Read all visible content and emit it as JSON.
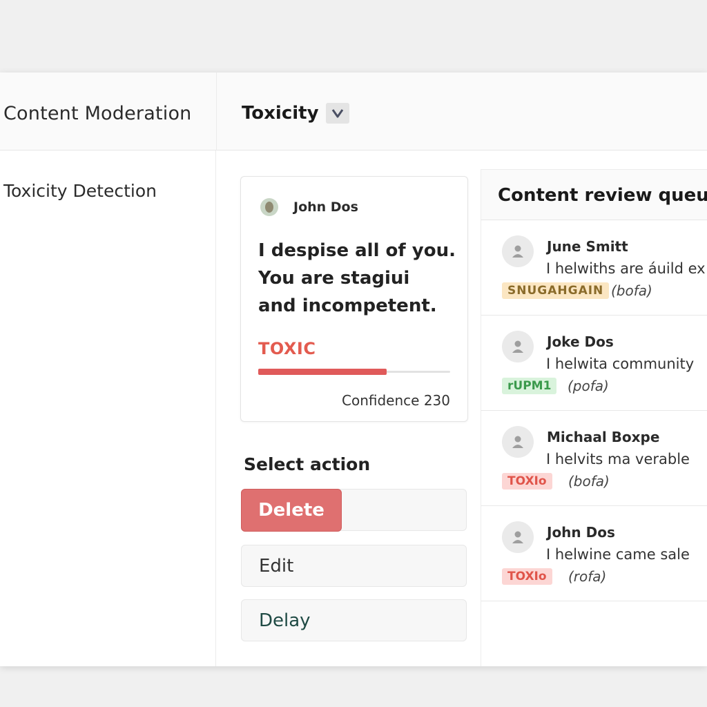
{
  "app": {
    "title": "Content Moderation"
  },
  "filter": {
    "label": "Toxicity",
    "icon": "chevron-down-icon"
  },
  "sidebar": {
    "items": [
      {
        "label": "Toxicity Detection"
      }
    ]
  },
  "card": {
    "author": "John Dos",
    "message_lines": [
      "I despise all of you.",
      "You are stagiui",
      "and incompetent."
    ],
    "label": "TOXIC",
    "confidence_bar_fraction": 0.67,
    "confidence_text": "Confidence 230"
  },
  "actions": {
    "title": "Select action",
    "items": [
      {
        "label": "Delete"
      },
      {
        "label": "Edit"
      },
      {
        "label": "Delay"
      }
    ]
  },
  "queue": {
    "title": "Content review queues",
    "items": [
      {
        "name": "June Smitt",
        "text": "I helwiths are áuild ex",
        "tag": "SNUGAHGAIN",
        "tag_type": "warn",
        "note": "(bofa)"
      },
      {
        "name": "Joke Dos",
        "text": "I helwita community",
        "tag": "rUPM1",
        "tag_type": "ok",
        "note": "(pofa)"
      },
      {
        "name": "Michaal Boxpe",
        "text": "I helvits ma verable",
        "tag": "TOXIo",
        "tag_type": "toxic",
        "note": "(bofa)"
      },
      {
        "name": "John Dos",
        "text": "I helwine came sale",
        "tag": "TOXIo",
        "tag_type": "toxic",
        "note": "(rofa)"
      }
    ]
  },
  "colors": {
    "toxic": "#e35b4f",
    "delete_button": "#df7070",
    "bar_fill": "#e05a5a",
    "tag_warn_bg": "#fbe6c2",
    "tag_ok_bg": "#d9f3dc",
    "tag_toxic_bg": "#fcd6d4"
  }
}
